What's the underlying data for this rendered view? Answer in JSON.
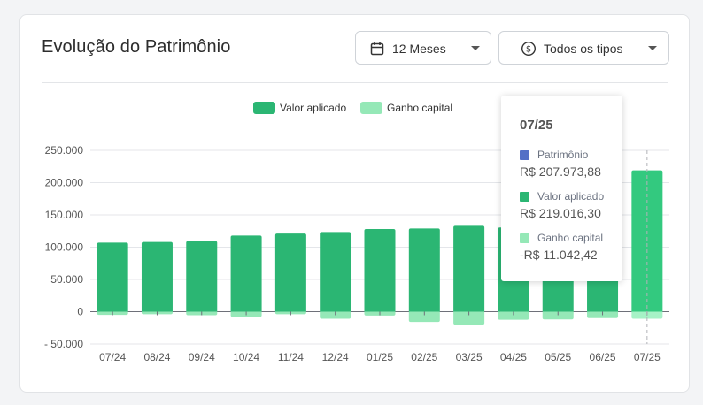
{
  "card": {
    "title": "Evolução do Patrimônio"
  },
  "filters": {
    "period": {
      "label": "12 Meses",
      "icon": "calendar-icon"
    },
    "type": {
      "label": "Todos os tipos",
      "icon": "dollar-circle-icon"
    }
  },
  "chart_data": {
    "type": "bar",
    "stacked": true,
    "categories": [
      "07/24",
      "08/24",
      "09/24",
      "10/24",
      "11/24",
      "12/24",
      "01/25",
      "02/25",
      "03/25",
      "04/25",
      "05/25",
      "06/25",
      "07/25"
    ],
    "series": [
      {
        "name": "Valor aplicado",
        "color": "#2bb673",
        "values": [
          107000,
          108000,
          109500,
          118000,
          121000,
          123500,
          128000,
          129000,
          133000,
          130500,
          128000,
          127000,
          219016.3
        ]
      },
      {
        "name": "Ganho capital",
        "color": "#95e8b7",
        "values": [
          -5000,
          -4000,
          -5500,
          -8000,
          -4000,
          -11000,
          -6000,
          -16000,
          -20000,
          -12500,
          -12000,
          -10000,
          -11042.42
        ]
      }
    ],
    "yticks": [
      "250.000",
      "200.000",
      "150.000",
      "100.000",
      "50.000",
      "0",
      "- 50.000"
    ],
    "ytick_values": [
      250000,
      200000,
      150000,
      100000,
      50000,
      0,
      -50000
    ],
    "ylim": [
      -50000,
      250000
    ],
    "legend_position": "top-center",
    "grid": true
  },
  "tooltip": {
    "title": "07/25",
    "items": [
      {
        "name": "Patrimônio",
        "value": "R$ 207.973,88",
        "color": "#5470c6"
      },
      {
        "name": "Valor aplicado",
        "value": "R$ 219.016,30",
        "color": "#2bb673"
      },
      {
        "name": "Ganho capital",
        "value": "-R$ 11.042,42",
        "color": "#95e8b7"
      }
    ]
  }
}
